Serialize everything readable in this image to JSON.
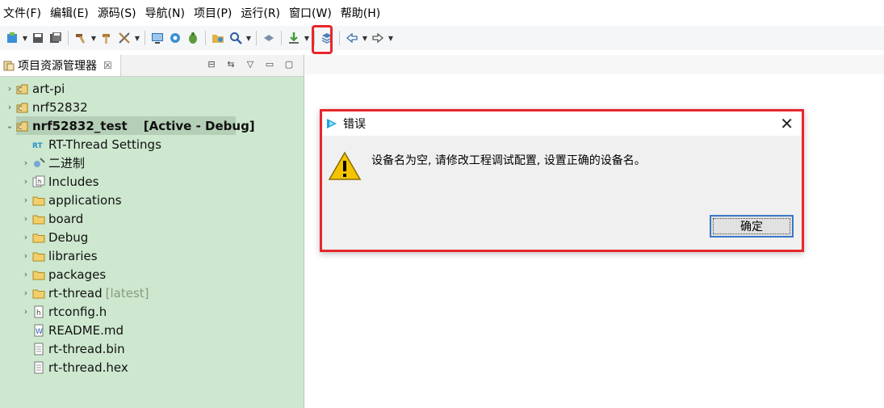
{
  "menubar": {
    "items": [
      "文件(F)",
      "编辑(E)",
      "源码(S)",
      "导航(N)",
      "项目(P)",
      "运行(R)",
      "窗口(W)",
      "帮助(H)"
    ]
  },
  "toolbar": {
    "icons": [
      "new-icon",
      "save-icon",
      "save-all-icon",
      "build-icon",
      "hammer-icon",
      "debug-config-icon",
      "monitor-icon",
      "gear-icon",
      "bug-icon",
      "open-folder-icon",
      "search-icon",
      "layer-icon",
      "download-icon",
      "stack-icon",
      "back-arrow-icon",
      "forward-arrow-icon"
    ],
    "highlighted": "download-icon"
  },
  "explorer": {
    "tab_label": "项目资源管理器",
    "tab_close": "☒",
    "items": [
      {
        "label": "art-pi",
        "suffix": "",
        "depth": 0,
        "expandable": true,
        "expanded": false,
        "icon": "project-icon",
        "bold": false
      },
      {
        "label": "nrf52832",
        "suffix": "",
        "depth": 0,
        "expandable": true,
        "expanded": false,
        "icon": "project-icon",
        "bold": false
      },
      {
        "label": "nrf52832_test",
        "suffix": "[Active - Debug]",
        "depth": 0,
        "expandable": true,
        "expanded": true,
        "icon": "project-icon",
        "bold": true
      },
      {
        "label": "RT-Thread Settings",
        "suffix": "",
        "depth": 1,
        "expandable": false,
        "icon": "rt-settings-icon",
        "bold": false
      },
      {
        "label": "二进制",
        "suffix": "",
        "depth": 1,
        "expandable": true,
        "expanded": false,
        "icon": "binaries-icon",
        "bold": false
      },
      {
        "label": "Includes",
        "suffix": "",
        "depth": 1,
        "expandable": true,
        "expanded": false,
        "icon": "includes-icon",
        "bold": false
      },
      {
        "label": "applications",
        "suffix": "",
        "depth": 1,
        "expandable": true,
        "expanded": false,
        "icon": "folder-icon",
        "bold": false
      },
      {
        "label": "board",
        "suffix": "",
        "depth": 1,
        "expandable": true,
        "expanded": false,
        "icon": "folder-icon",
        "bold": false
      },
      {
        "label": "Debug",
        "suffix": "",
        "depth": 1,
        "expandable": true,
        "expanded": false,
        "icon": "folder-icon",
        "bold": false
      },
      {
        "label": "libraries",
        "suffix": "",
        "depth": 1,
        "expandable": true,
        "expanded": false,
        "icon": "folder-icon",
        "bold": false
      },
      {
        "label": "packages",
        "suffix": "",
        "depth": 1,
        "expandable": true,
        "expanded": false,
        "icon": "folder-icon",
        "bold": false
      },
      {
        "label": "rt-thread",
        "suffix": "[latest]",
        "depth": 1,
        "expandable": true,
        "expanded": false,
        "icon": "folder-icon",
        "bold": false
      },
      {
        "label": "rtconfig.h",
        "suffix": "",
        "depth": 1,
        "expandable": true,
        "expanded": false,
        "icon": "header-file-icon",
        "bold": false
      },
      {
        "label": "README.md",
        "suffix": "",
        "depth": 1,
        "expandable": false,
        "icon": "word-file-icon",
        "bold": false
      },
      {
        "label": "rt-thread.bin",
        "suffix": "",
        "depth": 1,
        "expandable": false,
        "icon": "text-file-icon",
        "bold": false
      },
      {
        "label": "rt-thread.hex",
        "suffix": "",
        "depth": 1,
        "expandable": false,
        "icon": "text-file-icon",
        "bold": false
      }
    ]
  },
  "dialog": {
    "title": "错误",
    "message": "设备名为空, 请修改工程调试配置, 设置正确的设备名。",
    "ok_label": "确定",
    "close_glyph": "✕"
  },
  "colors": {
    "highlight_red": "#e8262c",
    "explorer_bg": "#cde8cf",
    "selected_row": "#b5cfb6",
    "ok_border": "#3a78c8"
  }
}
